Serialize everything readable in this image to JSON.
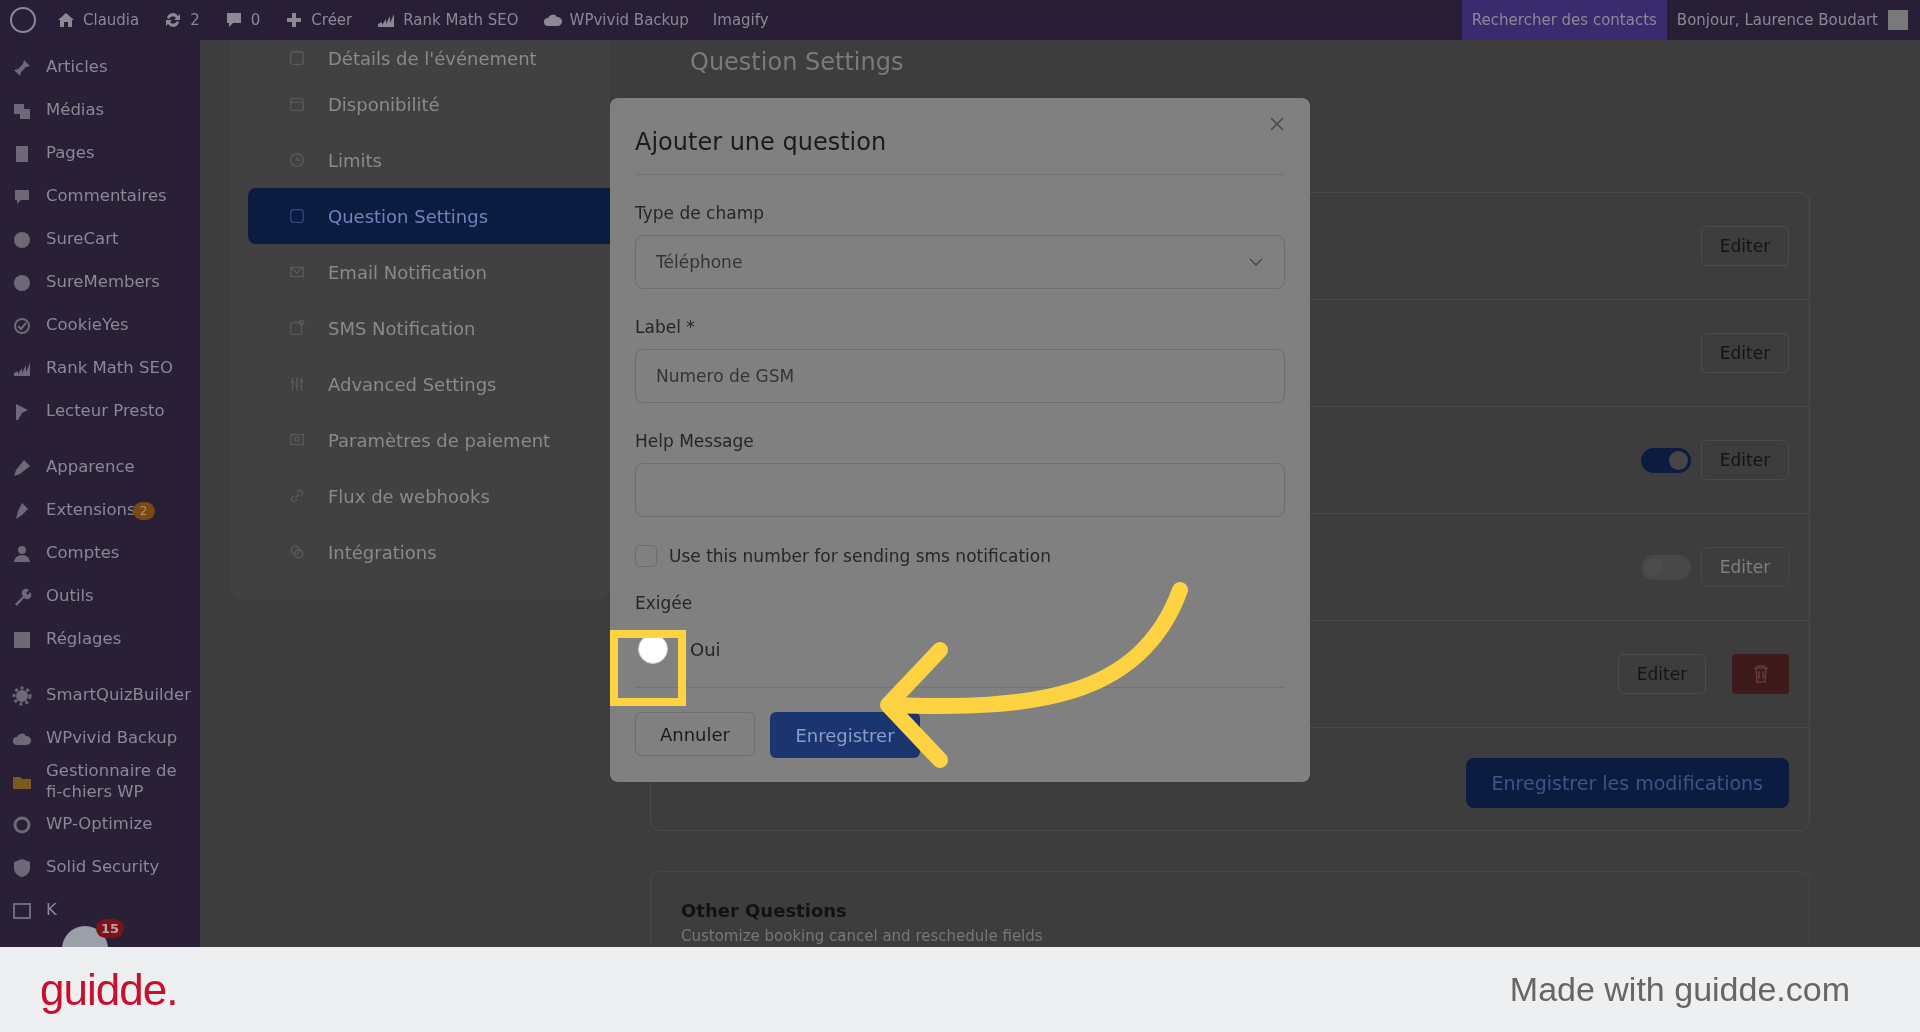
{
  "admin_bar": {
    "items": [
      {
        "label": "Claudia"
      },
      {
        "label": "2"
      },
      {
        "label": "0"
      },
      {
        "label": "Créer"
      },
      {
        "label": "Rank Math SEO"
      },
      {
        "label": "WPvivid Backup"
      },
      {
        "label": "Imagify"
      }
    ],
    "search_link": "Rechercher des contacts",
    "greeting": "Bonjour, Laurence Boudart"
  },
  "sidebar": {
    "groups": [
      {
        "items": [
          {
            "label": "Articles"
          },
          {
            "label": "Médias"
          },
          {
            "label": "Pages"
          },
          {
            "label": "Commentaires"
          },
          {
            "label": "SureCart"
          },
          {
            "label": "SureMembers"
          },
          {
            "label": "CookieYes"
          },
          {
            "label": "Rank Math SEO"
          },
          {
            "label": "Lecteur Presto"
          }
        ]
      },
      {
        "items": [
          {
            "label": "Apparence"
          },
          {
            "label": "Extensions",
            "badge": "2"
          },
          {
            "label": "Comptes"
          },
          {
            "label": "Outils"
          },
          {
            "label": "Réglages"
          }
        ]
      },
      {
        "items": [
          {
            "label": "SmartQuizBuilder"
          },
          {
            "label": "WPvivid Backup"
          },
          {
            "label": "Gestionnaire de fi-chiers WP"
          },
          {
            "label": "WP-Optimize"
          },
          {
            "label": "Solid Security"
          },
          {
            "label": "K"
          }
        ]
      }
    ],
    "floating_badge": "15"
  },
  "settings_nav": {
    "items": [
      {
        "label": "Détails de l'événement",
        "selected": false
      },
      {
        "label": "Disponibilité",
        "selected": false
      },
      {
        "label": "Limits",
        "selected": false
      },
      {
        "label": "Question Settings",
        "selected": true
      },
      {
        "label": "Email Notification",
        "selected": false
      },
      {
        "label": "SMS Notification",
        "selected": false
      },
      {
        "label": "Advanced Settings",
        "selected": false
      },
      {
        "label": "Paramètres de paiement",
        "selected": false
      },
      {
        "label": "Flux de webhooks",
        "selected": false
      },
      {
        "label": "Intégrations",
        "selected": false
      }
    ]
  },
  "content": {
    "title": "Question Settings",
    "rows": [
      {
        "kind": "plain",
        "button": "Editer",
        "disabled": false
      },
      {
        "kind": "plain",
        "button": "Editer",
        "disabled": false
      },
      {
        "kind": "toggle",
        "on": true,
        "button": "Editer",
        "disabled": false
      },
      {
        "kind": "toggle",
        "on": false,
        "button": "Editer",
        "disabled": true
      },
      {
        "kind": "deletable",
        "button": "Editer",
        "disabled": false
      }
    ],
    "save_button": "Enregistrer les modifications",
    "other_title": "Other Questions",
    "other_subtitle": "Customize booking cancel and reschedule fields"
  },
  "modal": {
    "title": "Ajouter une question",
    "field_type": {
      "label": "Type de champ",
      "value": "Téléphone"
    },
    "label_field": {
      "label": "Label *",
      "value": "Numero de GSM"
    },
    "help_field": {
      "label": "Help Message"
    },
    "sms_checkbox": {
      "label": "Use this number for sending sms notification",
      "checked": false
    },
    "required": {
      "label": "Exigée",
      "option": "Oui",
      "selected": false
    },
    "buttons": [
      "Annuler",
      "Enregistrer"
    ]
  },
  "footer_banner": {
    "logo": "guidde.",
    "credit": "Made with guidde.com"
  }
}
